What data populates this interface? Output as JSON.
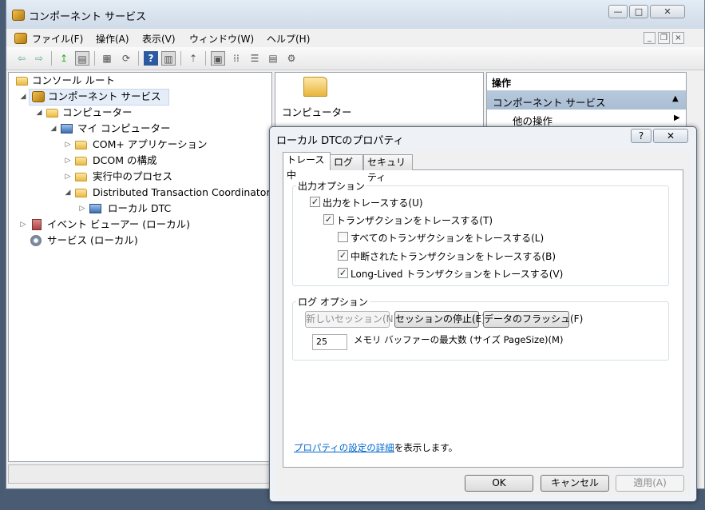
{
  "window": {
    "title": "コンポーネント サービス",
    "caption_buttons": {
      "minimize": "—",
      "maximize": "□",
      "close": "✕"
    }
  },
  "menu": [
    "ファイル(F)",
    "操作(A)",
    "表示(V)",
    "ウィンドウ(W)",
    "ヘルプ(H)"
  ],
  "mdi_buttons": {
    "minimize": "_",
    "restore": "❐",
    "close": "×"
  },
  "toolbar_icons": [
    "back-icon",
    "forward-icon",
    "up-folder-icon",
    "show-hide-console-tree-icon",
    "export-list-icon",
    "refresh-icon",
    "help-icon",
    "show-hide-action-pane-icon",
    "new-window-icon",
    "large-icons-view-icon",
    "small-icons-view-icon",
    "list-view-icon",
    "detail-view-icon",
    "settings-icon"
  ],
  "tree": {
    "root": "コンソール ルート",
    "component_services": "コンポーネント サービス",
    "computers": "コンピューター",
    "my_computer": "マイ コンピューター",
    "com_apps": "COM+ アプリケーション",
    "dcom": "DCOM の構成",
    "running": "実行中のプロセス",
    "dtc": "Distributed Transaction Coordinator",
    "local_dtc": "ローカル DTC",
    "event_viewer": "イベント ビューアー (ローカル)",
    "services": "サービス (ローカル)"
  },
  "list": {
    "item": "コンピューター"
  },
  "actions": {
    "header": "操作",
    "selected": "コンポーネント サービス",
    "other": "他の操作"
  },
  "dialog": {
    "title": "ローカル DTCのプロパティ",
    "help": "?",
    "close": "✕",
    "tabs": [
      "トレース中",
      "ログ",
      "セキュリティ"
    ],
    "output_group": "出力オプション",
    "checks": [
      {
        "label": "出力をトレースする(U)",
        "checked": true
      },
      {
        "label": "トランザクションをトレースする(T)",
        "checked": true
      },
      {
        "label": "すべてのトランザクションをトレースする(L)",
        "checked": false
      },
      {
        "label": "中断されたトランザクションをトレースする(B)",
        "checked": true
      },
      {
        "label": "Long-Lived トランザクションをトレースする(V)",
        "checked": true
      }
    ],
    "log_group": "ログ オプション",
    "log_buttons": {
      "new_session": "新しいセッション(N)",
      "stop_session": "セッションの停止(E)",
      "flush": "データのフラッシュ(F)"
    },
    "buffer_value": "25",
    "buffer_label": "メモリ バッファーの最大数 (サイズ PageSize)(M)",
    "link_text": "プロパティの設定の詳細",
    "link_suffix": "を表示します。",
    "ok": "OK",
    "cancel": "キャンセル",
    "apply": "適用(A)"
  },
  "check_mark": "✓",
  "colors": {
    "accent": "#0066cc",
    "selection": "#b8c9dd",
    "dialog_bg": "#eef2f7"
  }
}
